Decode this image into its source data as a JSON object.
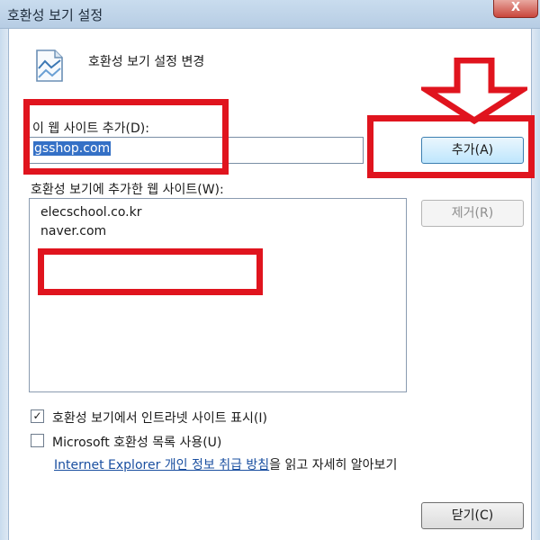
{
  "window": {
    "title": "호환성 보기 설정",
    "close_glyph": "X"
  },
  "header": {
    "text": "호환성 보기 설정 변경",
    "icon": "document-chart-icon"
  },
  "add_site": {
    "label": "이 웹 사이트 추가(D):",
    "value": "gsshop.com",
    "button_label": "추가(A)"
  },
  "site_list": {
    "label": "호환성 보기에 추가한 웹 사이트(W):",
    "items": [
      "elecschool.co.kr",
      "naver.com"
    ],
    "remove_label": "제거(R)"
  },
  "options": {
    "intranet_label": "호환성 보기에서 인트라넷 사이트 표시(I)",
    "intranet_checked": true,
    "intranet_check_glyph": "✓",
    "microsoft_label": "Microsoft 호환성 목록 사용(U)",
    "microsoft_checked": false
  },
  "privacy": {
    "link_text": "Internet Explorer 개인 정보 취급 방침",
    "suffix_text": "을 읽고 자세히 알아보기"
  },
  "footer": {
    "close_label": "닫기(C)"
  },
  "annotations": {
    "highlight_color": "#e0141e",
    "arrow_icon": "down-arrow-icon"
  }
}
